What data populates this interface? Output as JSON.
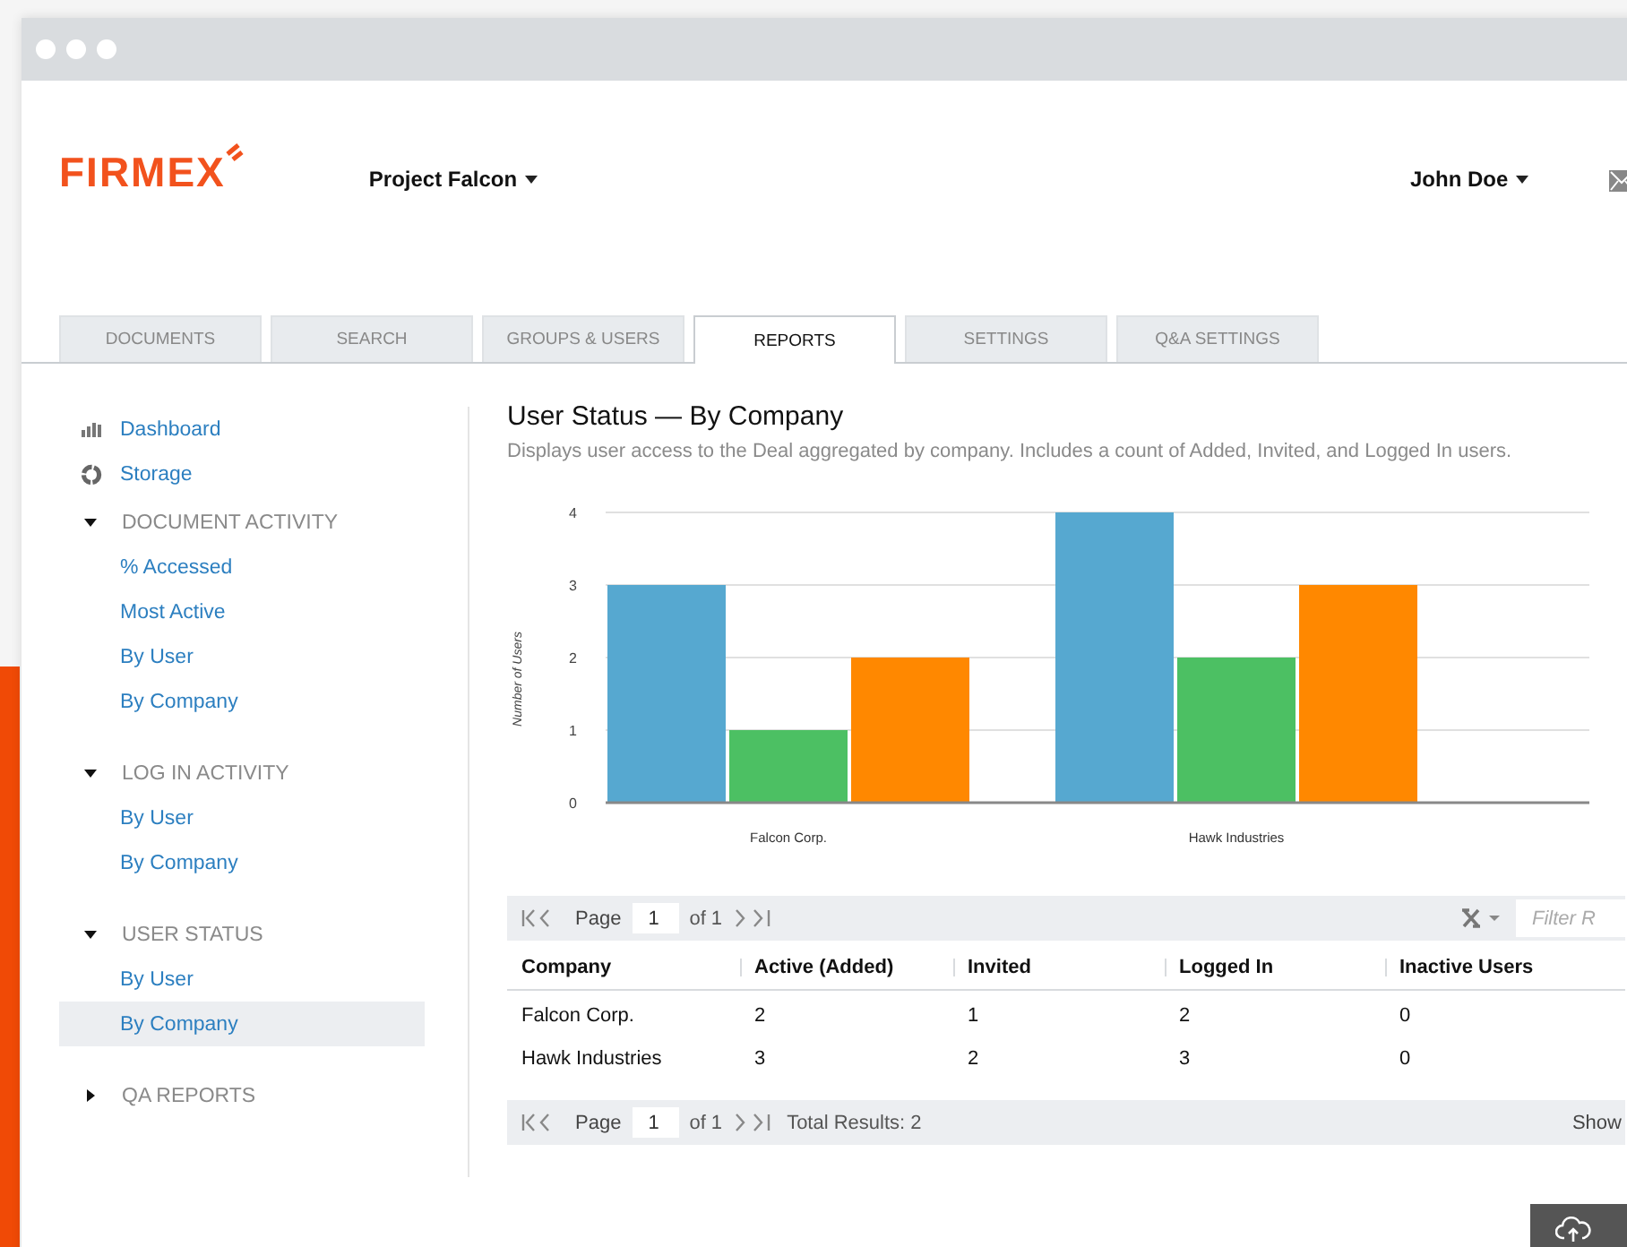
{
  "header": {
    "logo": "FIRMEX",
    "project": "Project Falcon",
    "user": "John Doe"
  },
  "tabs": [
    {
      "label": "DOCUMENTS",
      "selected": false
    },
    {
      "label": "SEARCH",
      "selected": false
    },
    {
      "label": "GROUPS & USERS",
      "selected": false
    },
    {
      "label": "REPORTS",
      "selected": true
    },
    {
      "label": "SETTINGS",
      "selected": false
    },
    {
      "label": "Q&A SETTINGS",
      "selected": false
    }
  ],
  "sidebar": {
    "items": [
      {
        "kind": "stats",
        "label": "Dashboard",
        "selected": false
      },
      {
        "kind": "storage",
        "label": "Storage",
        "selected": false
      },
      {
        "kind": "section",
        "label": "DOCUMENT ACTIVITY",
        "expanded": true,
        "children": [
          {
            "label": "% Accessed",
            "selected": false
          },
          {
            "label": "Most Active",
            "selected": false
          },
          {
            "label": "By User",
            "selected": false
          },
          {
            "label": "By Company",
            "selected": false
          }
        ]
      },
      {
        "kind": "section",
        "label": "LOG IN ACTIVITY",
        "expanded": true,
        "children": [
          {
            "label": "By User",
            "selected": false
          },
          {
            "label": "By Company",
            "selected": false
          }
        ]
      },
      {
        "kind": "section",
        "label": "USER STATUS",
        "expanded": true,
        "children": [
          {
            "label": "By User",
            "selected": false
          },
          {
            "label": "By Company",
            "selected": true
          }
        ]
      },
      {
        "kind": "section",
        "label": "QA REPORTS",
        "expanded": false
      }
    ]
  },
  "report": {
    "title": "User Status — By Company",
    "description": "Displays user access to the Deal aggregated by company. Includes a count of Added, Invited, and Logged In users.",
    "chart_data": {
      "type": "bar",
      "ylabel": "Number of Users",
      "categories": [
        "Falcon Corp.",
        "Hawk Industries"
      ],
      "yticks": [
        0,
        1,
        2,
        3,
        4
      ],
      "ylim": [
        0,
        4
      ],
      "grid": true,
      "series": [
        {
          "color": "#56a8d0",
          "values": [
            3,
            4
          ]
        },
        {
          "color": "#4cc063",
          "values": [
            1,
            2
          ]
        },
        {
          "color": "#ff8800",
          "values": [
            2,
            3
          ]
        }
      ]
    },
    "top_pager": {
      "page_label": "Page",
      "page": "1",
      "of": "of 1",
      "filter_placeholder": "Filter R"
    },
    "table": {
      "columns": [
        "Company",
        "Active (Added)",
        "Invited",
        "Logged In",
        "Inactive Users"
      ],
      "rows": [
        [
          "Falcon Corp.",
          "2",
          "1",
          "2",
          "0"
        ],
        [
          "Hawk Industries",
          "3",
          "2",
          "3",
          "0"
        ]
      ]
    },
    "bottom_pager": {
      "page_label": "Page",
      "page": "1",
      "of": "of 1",
      "total": "Total Results: 2",
      "show": "Show"
    }
  }
}
